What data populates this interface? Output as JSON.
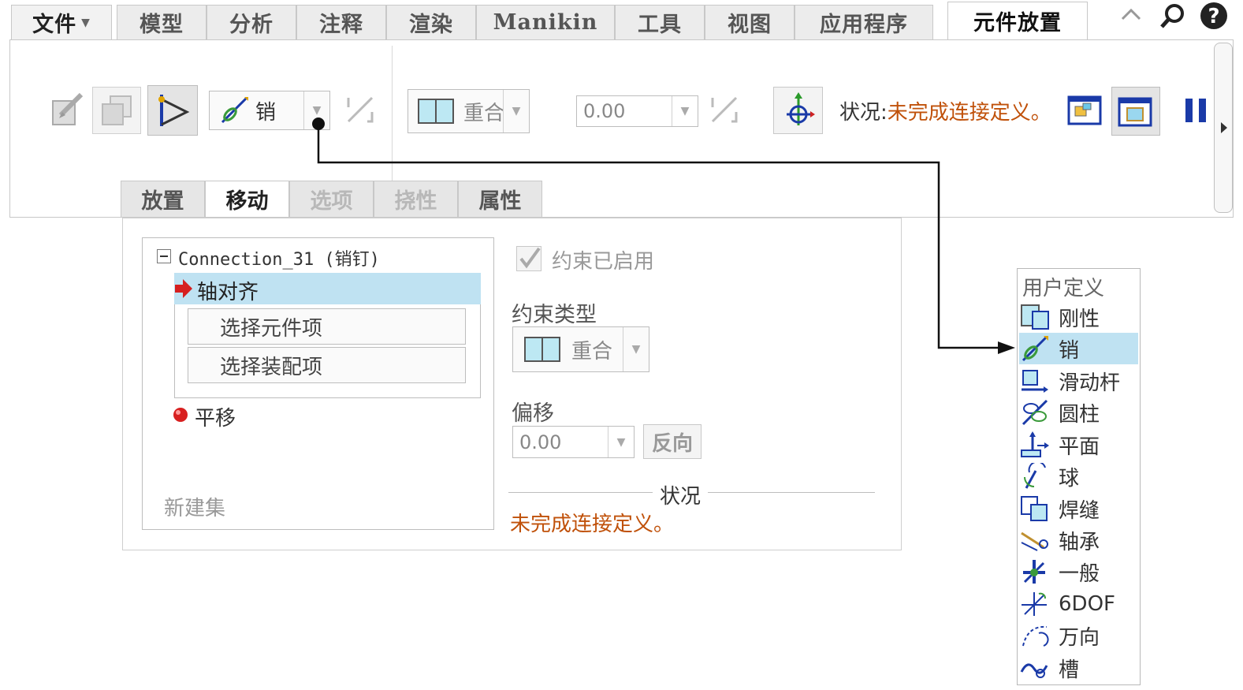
{
  "menu": {
    "tabs": [
      {
        "label": "文件"
      },
      {
        "label": "模型"
      },
      {
        "label": "分析"
      },
      {
        "label": "注释"
      },
      {
        "label": "渲染"
      },
      {
        "label": "Manikin"
      },
      {
        "label": "工具"
      },
      {
        "label": "视图"
      },
      {
        "label": "应用程序"
      },
      {
        "label": "元件放置"
      }
    ],
    "active_tab": "元件放置"
  },
  "ribbon": {
    "connection_type": "销",
    "constraint_type": "重合",
    "offset_value": "0.00",
    "status_label": "状况:",
    "status_message": "未完成连接定义。",
    "colors": {
      "status": "#c0510a",
      "accent": "#1a3aa8",
      "selection": "#bfe2f2"
    }
  },
  "subtabs": [
    {
      "label": "放置",
      "state": "normal"
    },
    {
      "label": "移动",
      "state": "active"
    },
    {
      "label": "选项",
      "state": "disabled"
    },
    {
      "label": "挠性",
      "state": "disabled"
    },
    {
      "label": "属性",
      "state": "normal"
    }
  ],
  "panel": {
    "tree": {
      "root": "Connection_31 (销钉)",
      "selected_item": "轴对齐",
      "sub_items": [
        "选择元件项",
        "选择装配项"
      ],
      "second_item": "平移",
      "new_set": "新建集"
    },
    "constraint_enabled": "约束已启用",
    "constraint_type_label": "约束类型",
    "constraint_type_value": "重合",
    "offset_label": "偏移",
    "offset_value": "0.00",
    "reverse_button": "反向",
    "status_title": "状况",
    "status_message": "未完成连接定义。"
  },
  "dropdown": {
    "header": "用户定义",
    "items": [
      {
        "label": "刚性",
        "icon": "rigid-icon"
      },
      {
        "label": "销",
        "icon": "pin-icon",
        "selected": true
      },
      {
        "label": "滑动杆",
        "icon": "slider-icon"
      },
      {
        "label": "圆柱",
        "icon": "cylinder-icon"
      },
      {
        "label": "平面",
        "icon": "planar-icon"
      },
      {
        "label": "球",
        "icon": "ball-icon"
      },
      {
        "label": "焊缝",
        "icon": "weld-icon"
      },
      {
        "label": "轴承",
        "icon": "bearing-icon"
      },
      {
        "label": "一般",
        "icon": "general-icon"
      },
      {
        "label": "6DOF",
        "icon": "6dof-icon"
      },
      {
        "label": "万向",
        "icon": "gimbal-icon"
      },
      {
        "label": "槽",
        "icon": "slot-icon"
      }
    ]
  }
}
